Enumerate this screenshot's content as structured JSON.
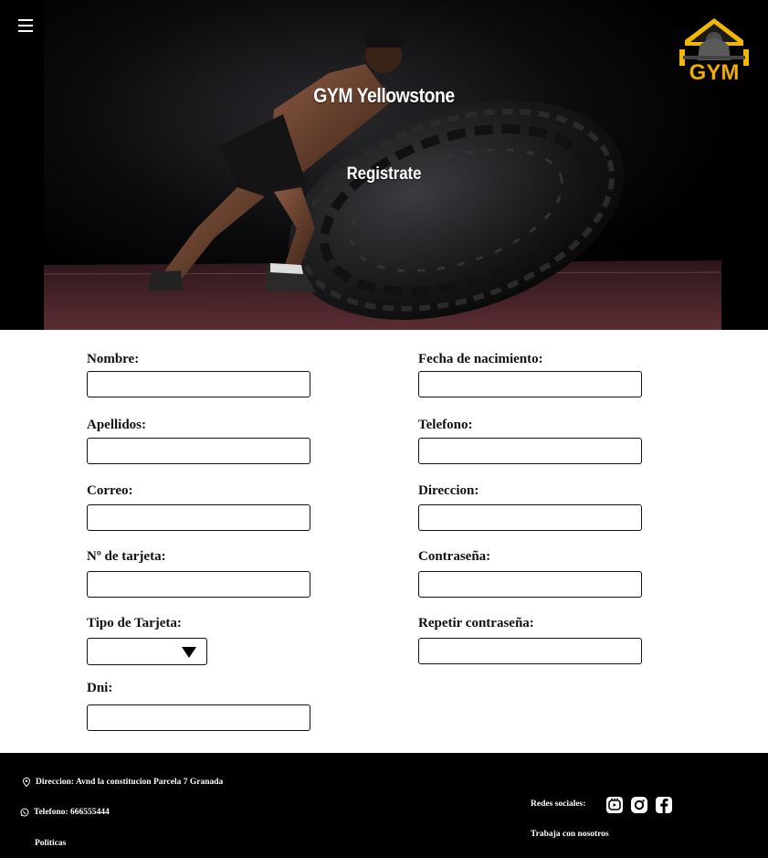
{
  "hero": {
    "title": "GYM Yellowstone",
    "subtitle": "Registrate",
    "logo_text": "GYM",
    "menu_icon": "hamburger-menu-icon"
  },
  "form": {
    "left": [
      {
        "label": "Nombre:",
        "value": ""
      },
      {
        "label": "Apellidos:",
        "value": ""
      },
      {
        "label": "Correo:",
        "value": ""
      },
      {
        "label": "Nº de tarjeta:",
        "value": ""
      },
      {
        "label": "Tipo de Tarjeta:",
        "value": ""
      },
      {
        "label": "Dni:",
        "value": ""
      }
    ],
    "right": [
      {
        "label": "Fecha de nacimiento:",
        "value": ""
      },
      {
        "label": "Telefono:",
        "value": ""
      },
      {
        "label": "Direccion:",
        "value": ""
      },
      {
        "label": "Contraseña:",
        "value": ""
      },
      {
        "label": "Repetir contraseña:",
        "value": ""
      }
    ]
  },
  "footer": {
    "address": "Direccion:  Avnd la constitucion Parcela 7 Granada",
    "phone": "Telefono: 666555444",
    "policies": "Politicas",
    "social_label": "Redes sociales:",
    "work_with_us": "Trabaja con nosotros",
    "social_icons": [
      "tiktok-icon",
      "instagram-icon",
      "facebook-icon"
    ]
  },
  "colors": {
    "logo_gold": "#f2b705",
    "background": "#ffffff",
    "footer": "#000000"
  }
}
